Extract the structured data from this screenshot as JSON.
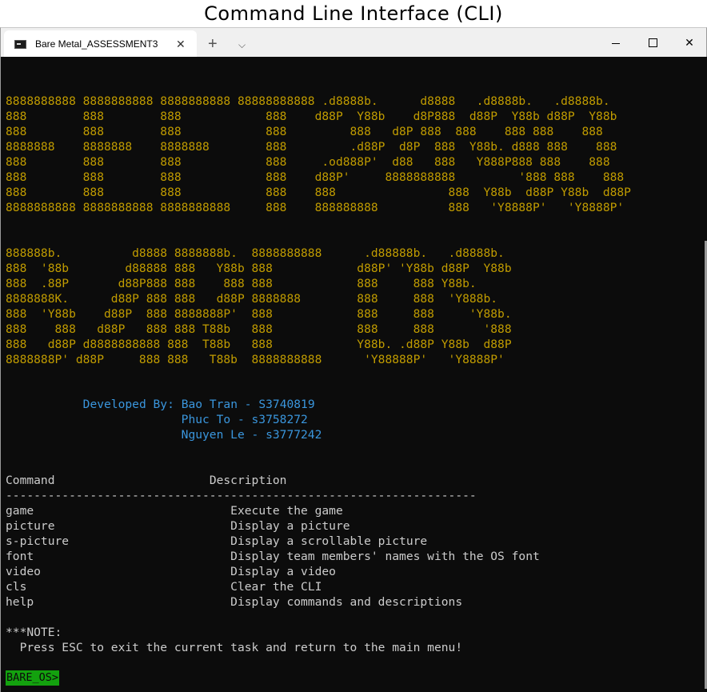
{
  "caption": "Command Line Interface (CLI)",
  "tab": {
    "title": "Bare Metal_ASSESSMENT3",
    "close_icon": "✕"
  },
  "titlebar": {
    "new_tab_icon": "+",
    "dropdown_icon": "⌵",
    "close_window_icon": "✕"
  },
  "banner": {
    "ascii_1": "8888888888 8888888888 8888888888 88888888888 .d8888b.      d8888   .d8888b.   .d8888b.\n888        888        888            888    d88P  Y88b    d8P888  d88P  Y88b d88P  Y88b\n888        888        888            888         888   d8P 888  888    888 888    888\n8888888    8888888    8888888        888         .d88P  d8P  888  Y88b. d888 888    888\n888        888        888            888     .od888P'  d88   888   Y888P888 888    888\n888        888        888            888    d88P'     8888888888         '888 888    888\n888        888        888            888    888                888  Y88b  d88P Y88b  d88P\n8888888888 8888888888 8888888888     888    888888888          888   'Y8888P'   'Y8888P'",
    "ascii_2": "888888b.          d8888 8888888b.  8888888888      .d88888b.   .d8888b.\n888  '88b        d88888 888   Y88b 888            d88P' 'Y88b d88P  Y88b\n888  .88P       d88P888 888    888 888            888     888 Y88b.\n8888888K.      d88P 888 888   d88P 8888888        888     888  'Y888b.\n888  'Y88b    d88P  888 8888888P'  888            888     888     'Y88b.\n888    888   d88P   888 888 T88b   888            888     888       '888\n888   d88P d8888888888 888  T88b   888            Y88b. .d88P Y88b  d88P\n8888888P' d88P     888 888   T88b  8888888888      'Y88888P'   'Y8888P'"
  },
  "credits": {
    "label": "Developed By:",
    "members": [
      "Bao Tran - S3740819",
      "Phuc To - s3758272",
      "Nguyen Le - s3777242"
    ]
  },
  "commands": {
    "header_command": "Command",
    "header_description": "Description",
    "separator": "-------------------------------------------------------------------",
    "rows": [
      {
        "name": "game",
        "description": "Execute the game"
      },
      {
        "name": "picture",
        "description": "Display a picture"
      },
      {
        "name": "s-picture",
        "description": "Display a scrollable picture"
      },
      {
        "name": "font",
        "description": "Display team members' names with the OS font"
      },
      {
        "name": "video",
        "description": "Display a video"
      },
      {
        "name": "cls",
        "description": "Clear the CLI"
      },
      {
        "name": "help",
        "description": "Display commands and descriptions"
      }
    ]
  },
  "note": {
    "title": "***NOTE:",
    "text": "Press ESC to exit the current task and return to the main menu!"
  },
  "prompt": "BARE_OS>",
  "colors": {
    "terminal_bg": "#0c0c0c",
    "banner": "#c19c00",
    "credits": "#3a96dd",
    "text": "#cccccc",
    "prompt_bg": "#13a10e"
  },
  "icons": {
    "tab_icon": "terminal-icon",
    "new_tab": "plus-icon",
    "dropdown": "chevron-down-icon",
    "minimize": "minimize-icon",
    "maximize": "maximize-icon",
    "close": "close-icon"
  }
}
